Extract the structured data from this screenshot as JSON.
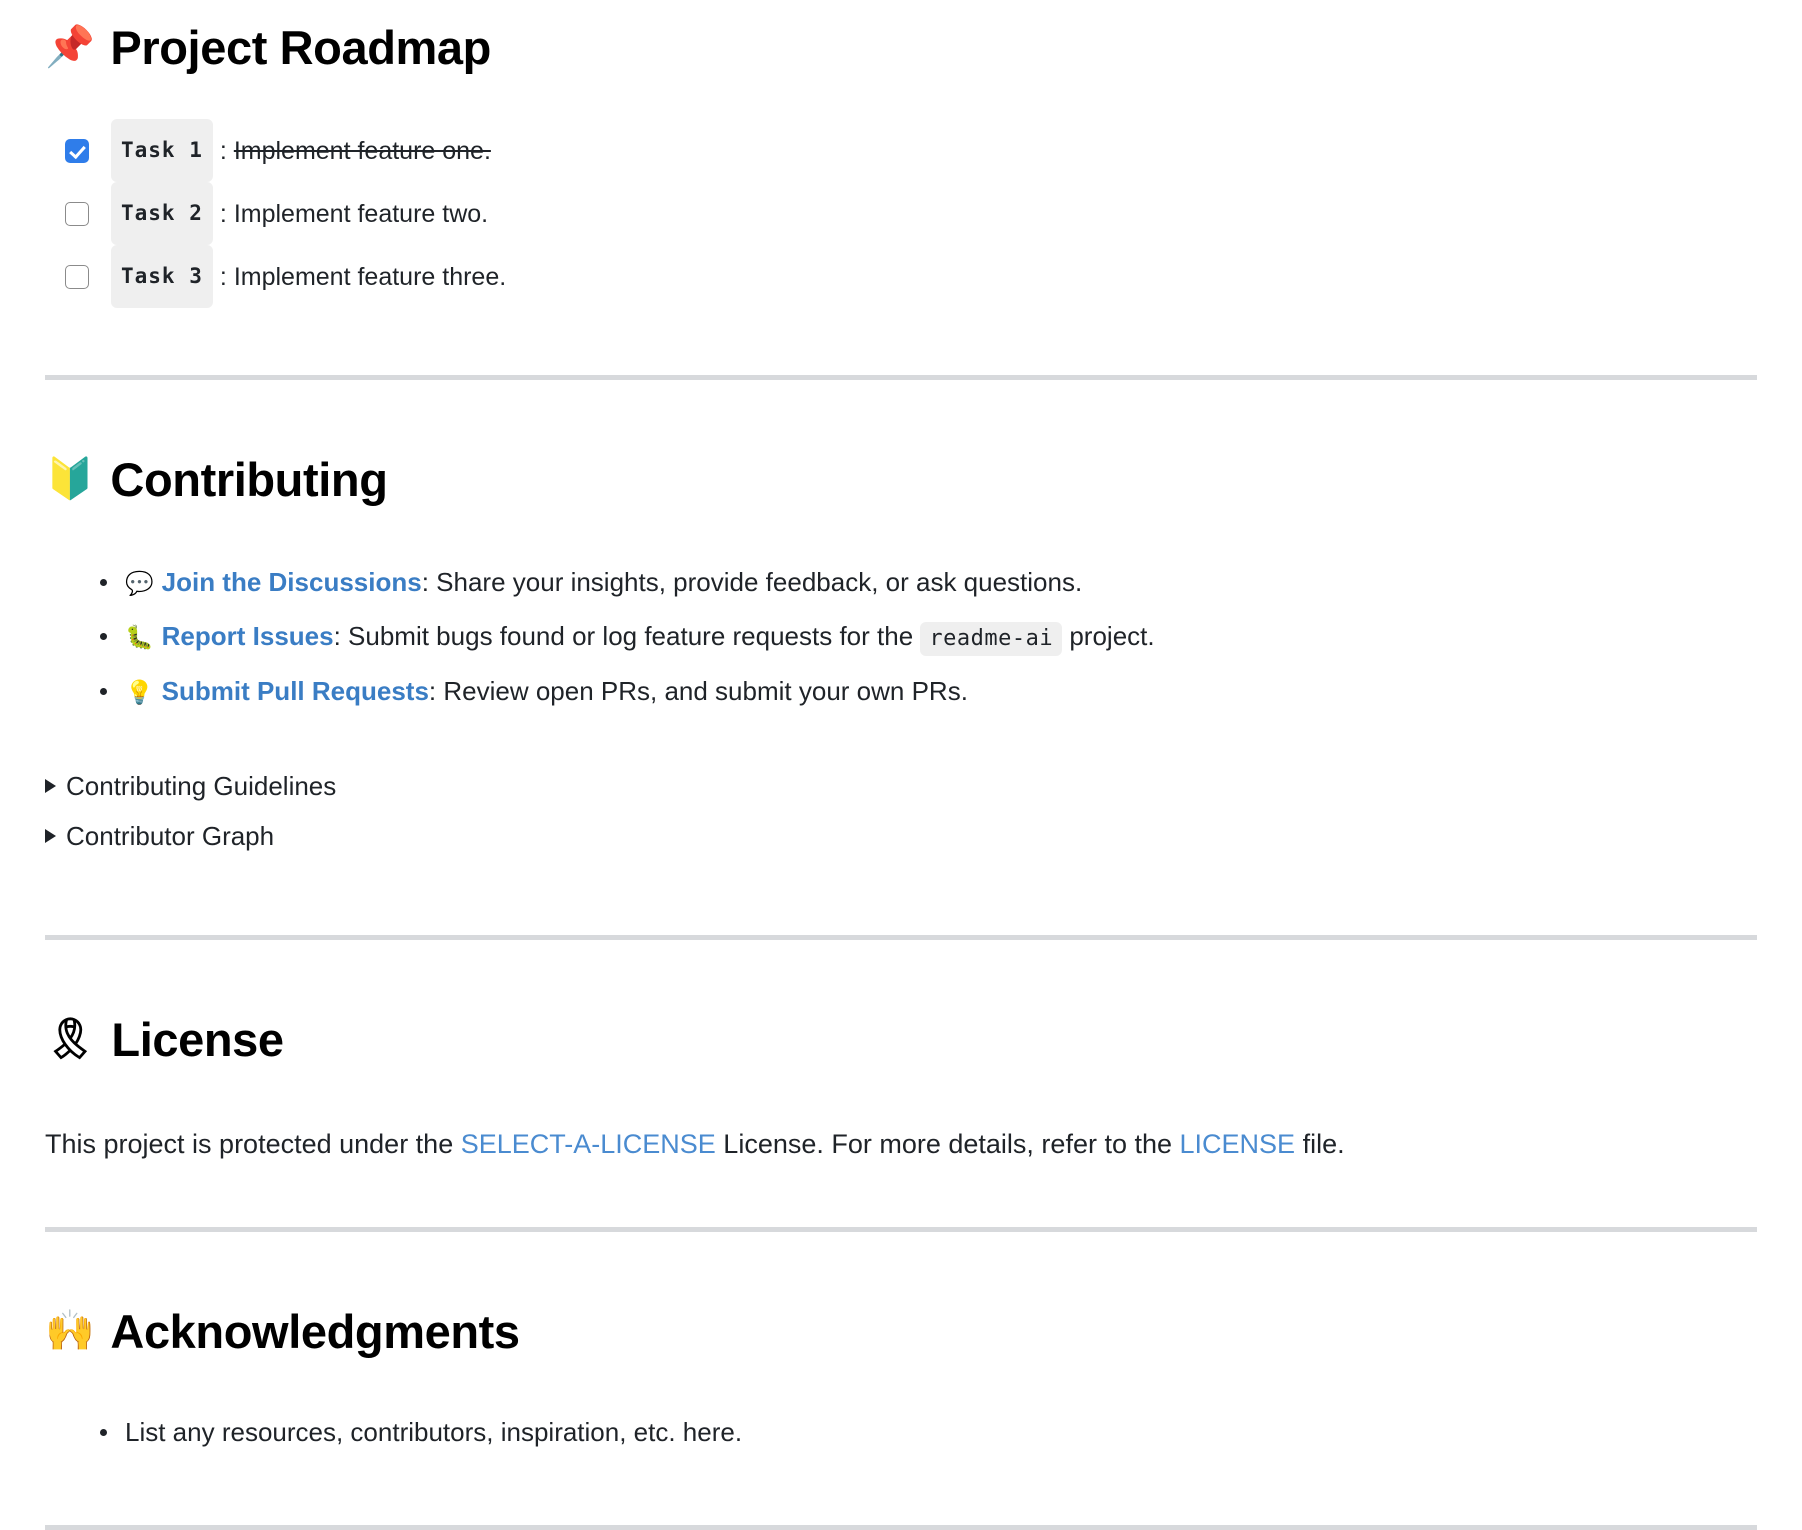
{
  "document": {
    "type": "github-readme-rendered-markdown",
    "link_color": "#3a7dc4",
    "checked_color": "#2f7dea",
    "code_bg": "#efefef",
    "hr_color": "#d7d9dc"
  },
  "roadmap": {
    "emoji": "📌",
    "emoji_name": "pushpin-emoji",
    "title": "Project Roadmap",
    "tasks": [
      {
        "label": "Task 1",
        "separator": ":",
        "text": "Implement feature one.",
        "checked": true
      },
      {
        "label": "Task 2",
        "separator": ":",
        "text": "Implement feature two.",
        "checked": false
      },
      {
        "label": "Task 3",
        "separator": ":",
        "text": "Implement feature three.",
        "checked": false
      }
    ]
  },
  "contributing": {
    "emoji": "🔰",
    "emoji_name": "beginner-badge-emoji",
    "title": "Contributing",
    "items": [
      {
        "emoji": "💬",
        "emoji_name": "speech-balloon-emoji",
        "link": "Join the Discussions",
        "rest": ": Share your insights, provide feedback, or ask questions."
      },
      {
        "emoji": "🐛",
        "emoji_name": "bug-emoji",
        "link": "Report Issues",
        "rest_before_code": ": Submit bugs found or log feature requests for the ",
        "code": "readme-ai",
        "rest_after_code": " project."
      },
      {
        "emoji": "💡",
        "emoji_name": "light-bulb-emoji",
        "link": "Submit Pull Requests",
        "rest": ": Review open PRs, and submit your own PRs."
      }
    ],
    "details": [
      {
        "summary": "Contributing Guidelines"
      },
      {
        "summary": "Contributor Graph"
      }
    ]
  },
  "license": {
    "emoji": "🎗",
    "emoji_name": "reminder-ribbon-emoji",
    "title": "License",
    "text_before": "This project is protected under the ",
    "link_1": "SELECT-A-LICENSE",
    "text_middle": " License. For more details, refer to the ",
    "link_2": "LICENSE",
    "text_after": " file."
  },
  "acknowledgments": {
    "emoji": "🙌",
    "emoji_name": "raising-hands-emoji",
    "title": "Acknowledgments",
    "items": [
      "List any resources, contributors, inspiration, etc. here."
    ]
  }
}
